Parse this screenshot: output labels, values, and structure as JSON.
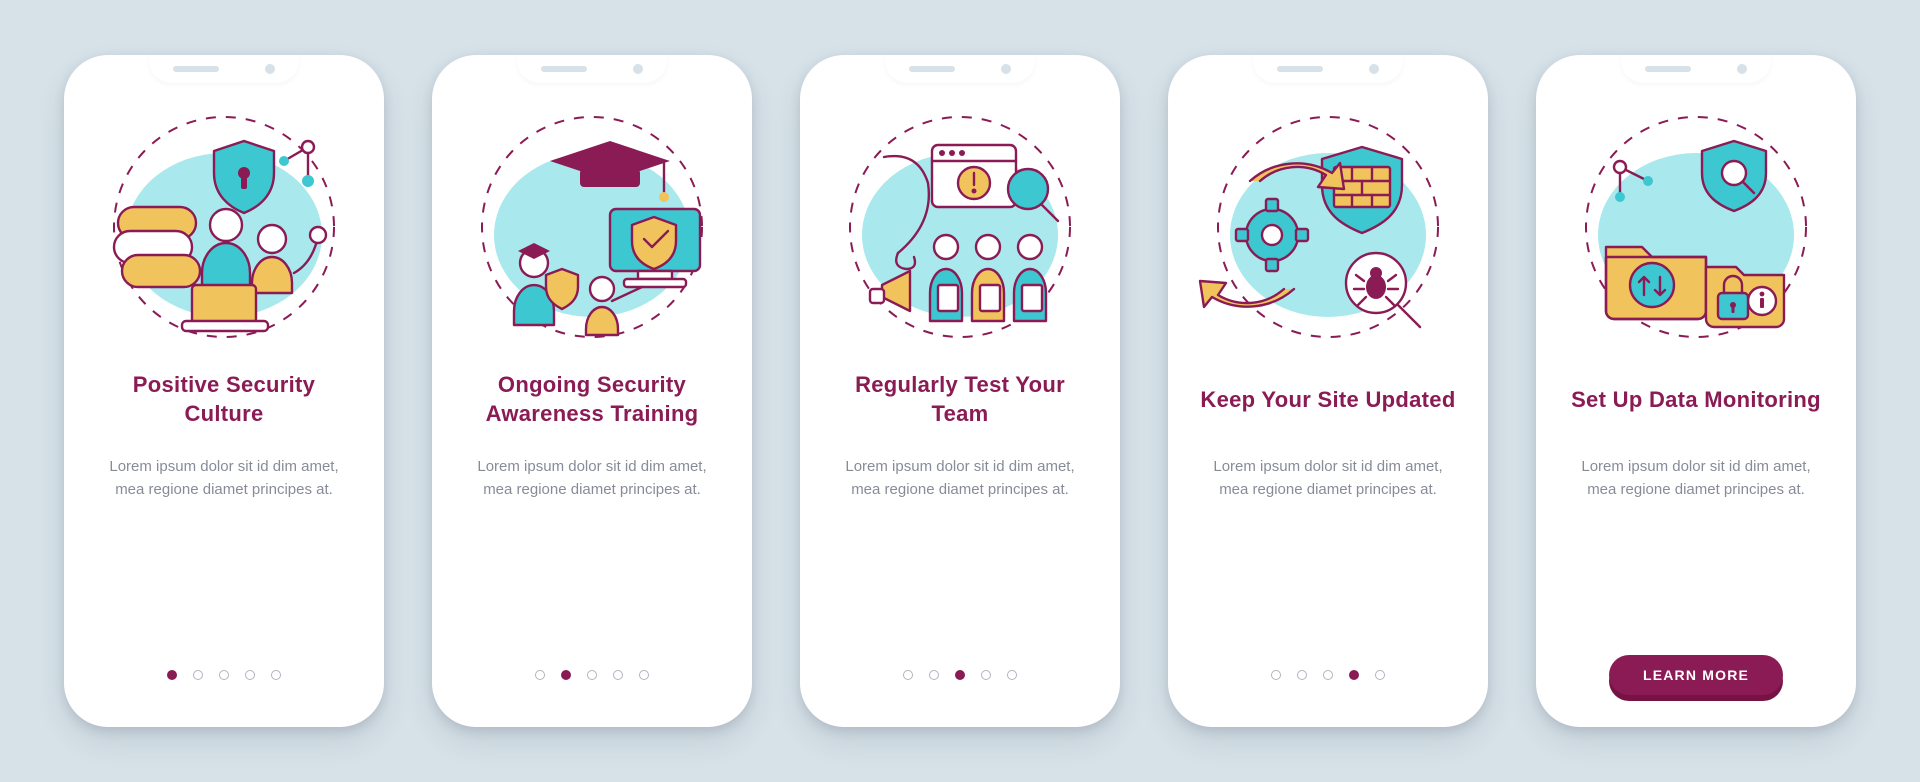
{
  "colors": {
    "background": "#d6e1e8",
    "card": "#ffffff",
    "accent": "#8a1b54",
    "accent_shadow": "#771245",
    "teal": "#3cc7d1",
    "teal_light": "#a9e9ed",
    "gold": "#f0c35c",
    "body_text": "#888c99",
    "dot_inactive": "#b9b0c0"
  },
  "cta_label": "LEARN MORE",
  "lorem": "Lorem ipsum dolor sit id dim amet, mea regione diamet principes at.",
  "slides": [
    {
      "id": "positive-security-culture",
      "illustration": "team-shield-icon",
      "title": "Positive Security Culture",
      "body": "Lorem ipsum dolor sit id dim amet, mea regione diamet principes at.",
      "dot_active_index": 0,
      "dot_count": 5,
      "has_cta": false
    },
    {
      "id": "ongoing-security-awareness-training",
      "illustration": "graduation-shield-monitor-icon",
      "title": "Ongoing Security Awareness Training",
      "body": "Lorem ipsum dolor sit id dim amet, mea regione diamet principes at.",
      "dot_active_index": 1,
      "dot_count": 5,
      "has_cta": false
    },
    {
      "id": "regularly-test-your-team",
      "illustration": "phishing-team-alert-icon",
      "title": "Regularly Test Your Team",
      "body": "Lorem ipsum dolor sit id dim amet, mea regione diamet principes at.",
      "dot_active_index": 2,
      "dot_count": 5,
      "has_cta": false
    },
    {
      "id": "keep-your-site-updated",
      "illustration": "update-firewall-bug-icon",
      "title": "Keep Your Site Updated",
      "body": "Lorem ipsum dolor sit id dim amet, mea regione diamet principes at.",
      "dot_active_index": 3,
      "dot_count": 5,
      "has_cta": false
    },
    {
      "id": "set-up-data-monitoring",
      "illustration": "folder-lock-shield-search-icon",
      "title": "Set Up Data Monitoring",
      "body": "Lorem ipsum dolor sit id dim amet, mea regione diamet principes at.",
      "dot_active_index": 4,
      "dot_count": 5,
      "has_cta": true
    }
  ]
}
